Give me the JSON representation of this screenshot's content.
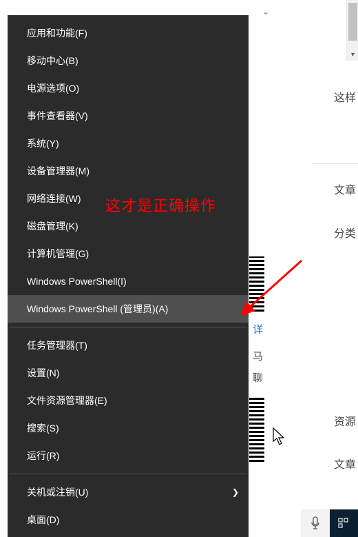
{
  "menu": {
    "items": [
      {
        "label": "应用和功能(F)",
        "highlight": false,
        "submenu": false
      },
      {
        "label": "移动中心(B)",
        "highlight": false,
        "submenu": false
      },
      {
        "label": "电源选项(O)",
        "highlight": false,
        "submenu": false
      },
      {
        "label": "事件查看器(V)",
        "highlight": false,
        "submenu": false
      },
      {
        "label": "系统(Y)",
        "highlight": false,
        "submenu": false
      },
      {
        "label": "设备管理器(M)",
        "highlight": false,
        "submenu": false
      },
      {
        "label": "网络连接(W)",
        "highlight": false,
        "submenu": false
      },
      {
        "label": "磁盘管理(K)",
        "highlight": false,
        "submenu": false
      },
      {
        "label": "计算机管理(G)",
        "highlight": false,
        "submenu": false
      },
      {
        "label": "Windows PowerShell(I)",
        "highlight": false,
        "submenu": false
      },
      {
        "label": "Windows PowerShell (管理员)(A)",
        "highlight": true,
        "submenu": false
      },
      {
        "sep": true
      },
      {
        "label": "任务管理器(T)",
        "highlight": false,
        "submenu": false
      },
      {
        "label": "设置(N)",
        "highlight": false,
        "submenu": false
      },
      {
        "label": "文件资源管理器(E)",
        "highlight": false,
        "submenu": false
      },
      {
        "label": "搜索(S)",
        "highlight": false,
        "submenu": false
      },
      {
        "label": "运行(R)",
        "highlight": false,
        "submenu": false
      },
      {
        "sep": true
      },
      {
        "label": "关机或注销(U)",
        "highlight": false,
        "submenu": true
      },
      {
        "label": "桌面(D)",
        "highlight": false,
        "submenu": false
      }
    ]
  },
  "annotation": {
    "text": "这才是正确操作"
  },
  "page": {
    "line1": "这样",
    "heading1": "文章",
    "heading2": "分类",
    "heading3": "资源",
    "heading4": "文章",
    "snippet_blue": "详",
    "snippet_a": "马",
    "snippet_b": "聊"
  },
  "icons": {
    "chevron_right": "❯",
    "chevron_down": "⌄",
    "mic": "mic",
    "scroll_down": "▾"
  }
}
